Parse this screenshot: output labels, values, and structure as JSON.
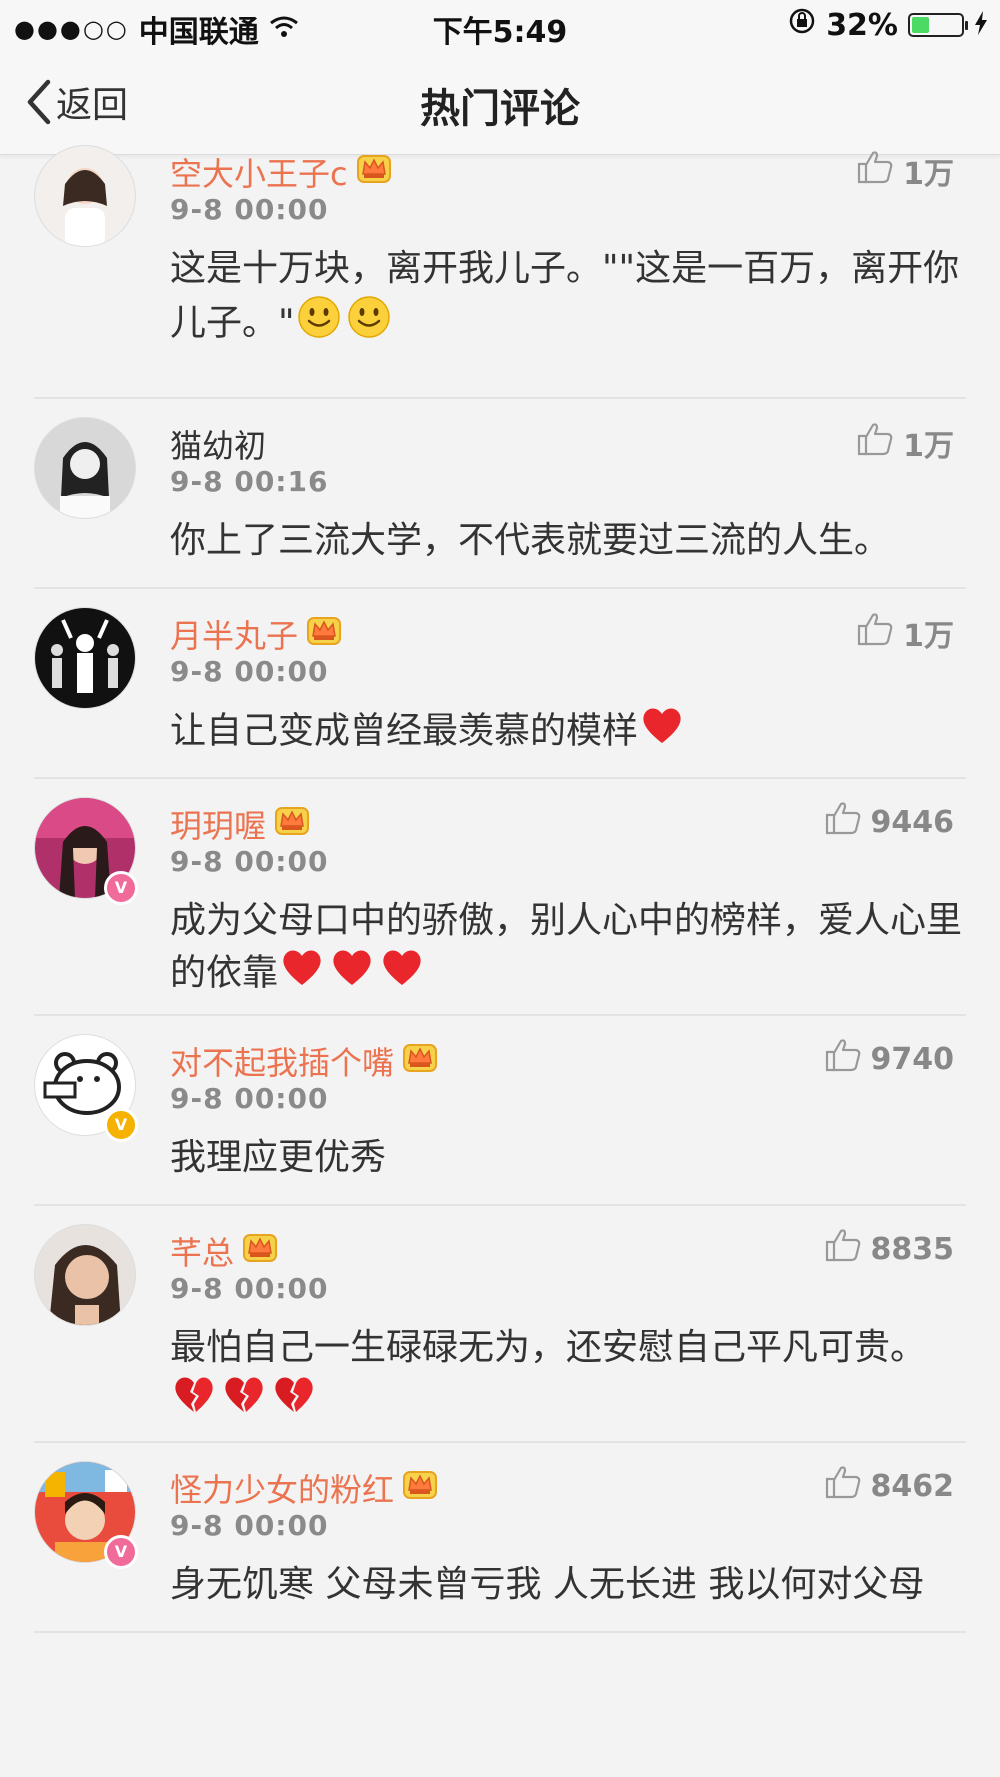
{
  "status": {
    "signal": "●●●○○",
    "carrier": "中国联通",
    "time": "下午5:49",
    "battery": "32%",
    "battery_level": 0.32
  },
  "nav": {
    "back_label": "返回",
    "title": "热门评论"
  },
  "comments": [
    {
      "name": "空大小王子c",
      "time": "9-8 00:00",
      "likes": "1万",
      "text": "这是十万块，离开我儿子。\"\"这是一百万，离开你儿子。\"",
      "emoji": [
        "smile-emoji",
        "smile-emoji"
      ]
    },
    {
      "name": "猫幼初",
      "time": "9-8 00:16",
      "likes": "1万",
      "text": "你上了三流大学，不代表就要过三流的人生。",
      "emoji": []
    },
    {
      "name": "月半丸子",
      "time": "9-8 00:00",
      "likes": "1万",
      "text": "让自己变成曾经最羡慕的模样",
      "emoji": [
        "heart-emoji"
      ]
    },
    {
      "name": "玥玥喔",
      "time": "9-8 00:00",
      "likes": "9446",
      "text": "成为父母口中的骄傲，别人心中的榜样，爱人心里的依靠",
      "emoji": [
        "heart-emoji",
        "heart-emoji",
        "heart-emoji"
      ]
    },
    {
      "name": "对不起我插个嘴",
      "time": "9-8 00:00",
      "likes": "9740",
      "text": "我理应更优秀",
      "emoji": []
    },
    {
      "name": "芊总",
      "time": "9-8 00:00",
      "likes": "8835",
      "text": "最怕自己一生碌碌无为，还安慰自己平凡可贵。",
      "emoji": [
        "broken-heart-emoji",
        "broken-heart-emoji",
        "broken-heart-emoji"
      ]
    },
    {
      "name": "怪力少女的粉红",
      "time": "9-8 00:00",
      "likes": "8462",
      "text": "身无饥寒 父母未曾亏我 人无长进 我以何对父母",
      "emoji": []
    }
  ],
  "colors": {
    "vip_name": "#eb7350",
    "text": "#333333",
    "meta": "#8a8a8a",
    "background": "#f3f3f3",
    "battery": "#4cd964"
  }
}
